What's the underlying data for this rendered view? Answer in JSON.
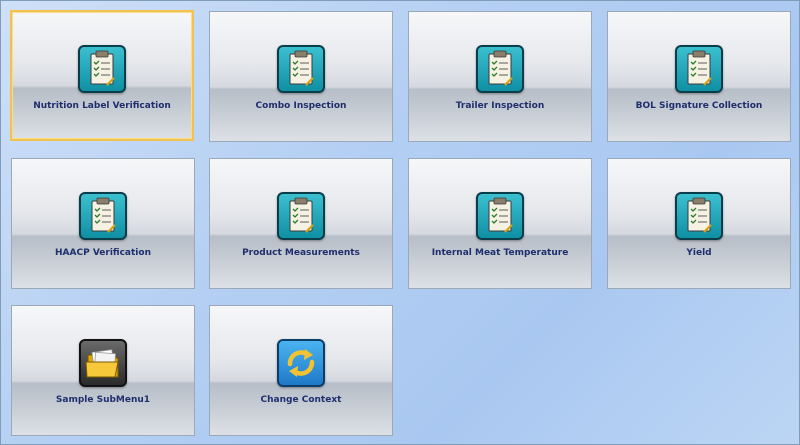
{
  "tiles": [
    {
      "label": "Nutrition Label Verification",
      "icon": "clipboard-checklist-icon",
      "selected": true
    },
    {
      "label": "Combo Inspection",
      "icon": "clipboard-checklist-icon"
    },
    {
      "label": "Trailer Inspection",
      "icon": "clipboard-checklist-icon"
    },
    {
      "label": "BOL Signature Collection",
      "icon": "clipboard-checklist-icon"
    },
    {
      "label": "HAACP Verification",
      "icon": "clipboard-checklist-icon"
    },
    {
      "label": "Product Measurements",
      "icon": "clipboard-checklist-icon"
    },
    {
      "label": "Internal Meat Temperature",
      "icon": "clipboard-checklist-icon"
    },
    {
      "label": "Yield",
      "icon": "clipboard-checklist-icon"
    },
    {
      "label": "Sample SubMenu1",
      "icon": "folder-icon"
    },
    {
      "label": "Change Context",
      "icon": "refresh-arrows-icon"
    }
  ],
  "colors": {
    "label_text": "#1f2f6d",
    "selected_border": "#f2c14e",
    "clipboard_icon_bg": "#0f8fa3",
    "folder_icon_bg": "#3a3a3a",
    "refresh_icon_bg": "#1e8ad8"
  }
}
